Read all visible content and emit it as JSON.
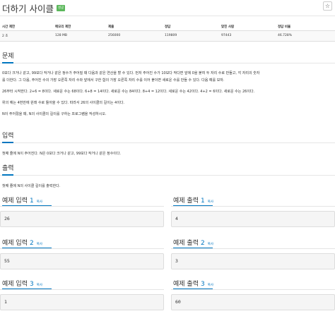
{
  "problem": {
    "title": "더하기 사이클",
    "badge": "성공",
    "star": "☆"
  },
  "info_table": {
    "headers": [
      "시간 제한",
      "메모리 제한",
      "제출",
      "정답",
      "맞힌 사람",
      "정답 비율"
    ],
    "values": [
      "2 초",
      "128 MB",
      "256000",
      "119809",
      "97443",
      "46.728%"
    ]
  },
  "sections": {
    "problem": {
      "heading": "문제",
      "paragraphs": [
        "0보다 크거나 같고, 99보다 작거나 같은 정수가 주어질 때 다음과 같은 연산을 할 수 있다. 먼저 주어진 수가 10보다 작다면 앞에 0을 붙여 두 자리 수로 만들고, 각 자리의 숫자",
        "를 더한다. 그 다음, 주어진 수의 가장 오른쪽 자리 수와 앞에서 구한 합의 가장 오른쪽 자리 수를 이어 붙이면 새로운 수를 만들 수 있다. 다음 예를 보자.",
        "26부터 시작한다. 2+6 = 8이다. 새로운 수는 68이다. 6+8 = 14이다. 새로운 수는 84이다. 8+4 = 12이다. 새로운 수는 42이다. 4+2 = 6이다. 새로운 수는 26이다.",
        "위의 예는 4번만에 원래 수로 돌아올 수 있다. 따라서 26의 사이클의 길이는 4이다.",
        "N이 주어졌을 때, N의 사이클의 길이를 구하는 프로그램을 작성하시오."
      ]
    },
    "input": {
      "heading": "입력",
      "text": "첫째 줄에 N이 주어진다. N은 0보다 크거나 같고, 99보다 작거나 같은 정수이다."
    },
    "output": {
      "heading": "출력",
      "text": "첫째 줄에 N의 사이클 길이를 출력한다."
    }
  },
  "samples": {
    "input_label": "예제 입력",
    "output_label": "예제 출력",
    "copy_label": "복사",
    "items": [
      {
        "num": "1",
        "input": "26",
        "output": "4"
      },
      {
        "num": "2",
        "input": "55",
        "output": "3"
      },
      {
        "num": "3",
        "input": "1",
        "output": "60"
      }
    ]
  }
}
